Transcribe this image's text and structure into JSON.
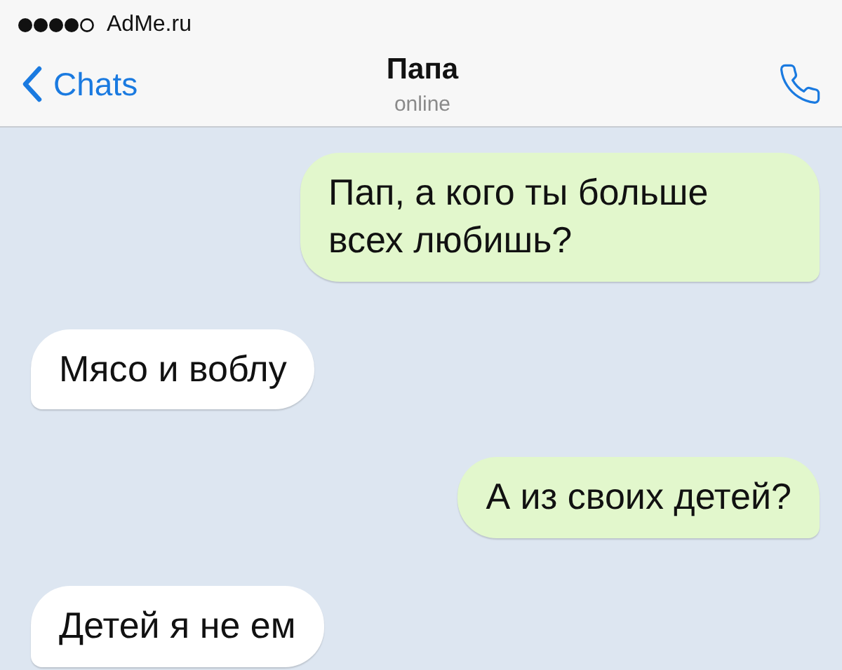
{
  "status_bar": {
    "carrier": "AdMe.ru"
  },
  "header": {
    "back": "Chats",
    "title": "Папа",
    "subtitle": "online"
  },
  "messages": [
    {
      "kind": "outgoing",
      "text": "Пап, а кого ты больше всех любишь?"
    },
    {
      "kind": "incoming",
      "text": "Мясо и воблу"
    },
    {
      "kind": "outgoing",
      "text": "А из своих детей?"
    },
    {
      "kind": "incoming",
      "text": "Детей я не ем"
    }
  ]
}
